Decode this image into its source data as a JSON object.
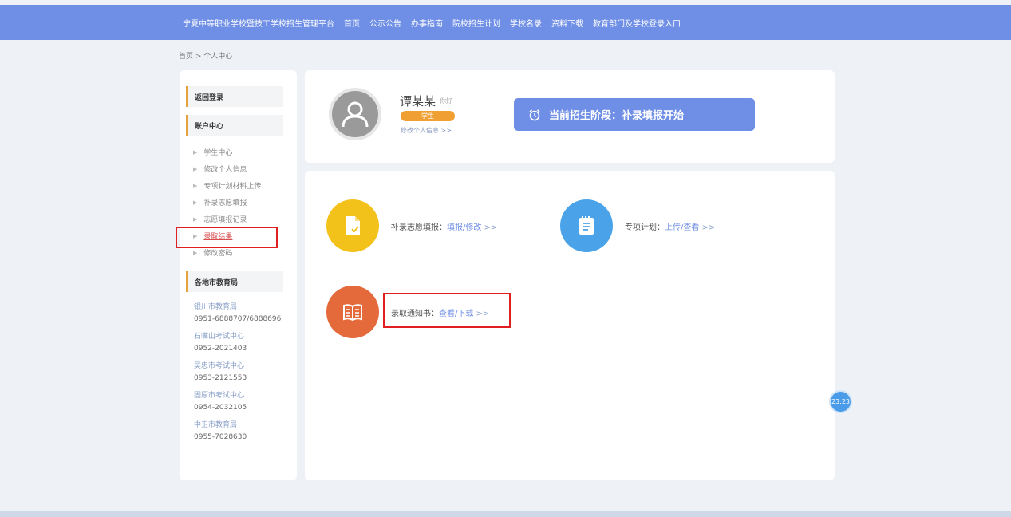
{
  "topnav": {
    "platform_title": "宁夏中等职业学校暨技工学校招生管理平台",
    "items": [
      "首页",
      "公示公告",
      "办事指南",
      "院校招生计划",
      "学校名录",
      "资料下载",
      "教育部门及学校登录入口"
    ]
  },
  "breadcrumb": "首页 > 个人中心",
  "sidebar": {
    "back_login": "返回登录",
    "account_center": "账户中心",
    "menu": [
      {
        "label": "学生中心"
      },
      {
        "label": "修改个人信息"
      },
      {
        "label": "专项计划材料上传"
      },
      {
        "label": "补录志愿填报"
      },
      {
        "label": "志愿填报记录"
      },
      {
        "label": "录取结果"
      },
      {
        "label": "修改密码"
      }
    ],
    "bureaus_title": "各地市教育局",
    "contacts": [
      {
        "name": "银川市教育局",
        "phone": "0951-6888707/6888696"
      },
      {
        "name": "石嘴山考试中心",
        "phone": "0952-2021403"
      },
      {
        "name": "吴忠市考试中心",
        "phone": "0953-2121553"
      },
      {
        "name": "固原市考试中心",
        "phone": "0954-2032105"
      },
      {
        "name": "中卫市教育局",
        "phone": "0955-7028630"
      }
    ]
  },
  "profile": {
    "name": "谭某某",
    "greeting": "你好",
    "role": "学生",
    "edit_link": "修改个人信息 >>"
  },
  "stage_banner": "当前招生阶段：补录填报开始",
  "actions": {
    "supplement": {
      "label": "补录志愿填报：",
      "link": "填报/修改",
      "suffix": " >>"
    },
    "special": {
      "label": "专项计划：",
      "link": "上传/查看",
      "suffix": " >>"
    },
    "notice": {
      "label": "录取通知书：",
      "link": "查看/下载",
      "suffix": " >>"
    }
  },
  "time_badge": "23:23",
  "colors": {
    "primary": "#6f8fe6",
    "yellow": "#f3c21a",
    "blue": "#4aa3e8",
    "orange": "#e46a3c",
    "highlight_red": "#e02020"
  }
}
